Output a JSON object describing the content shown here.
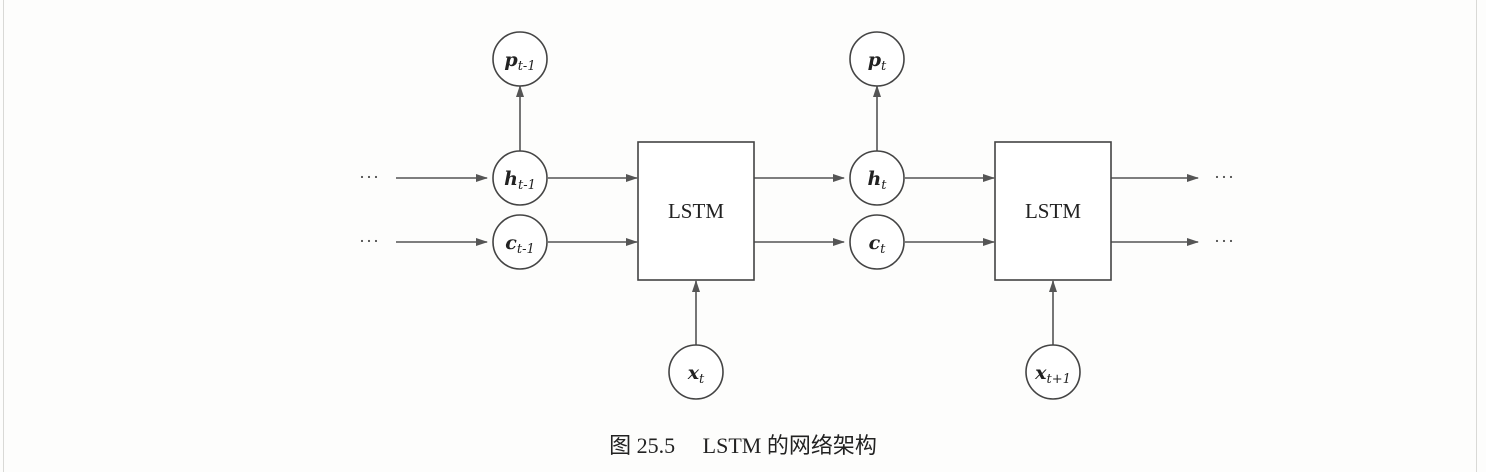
{
  "diagram": {
    "lstm_label": "LSTM",
    "ellipsis": "···",
    "nodes": {
      "p_prev": {
        "main": "p",
        "sub": "t-1"
      },
      "p_t": {
        "main": "p",
        "sub": "t"
      },
      "h_prev": {
        "main": "h",
        "sub": "t-1"
      },
      "c_prev": {
        "main": "c",
        "sub": "t-1"
      },
      "h_t": {
        "main": "h",
        "sub": "t"
      },
      "c_t": {
        "main": "c",
        "sub": "t"
      },
      "x_t": {
        "main": "x",
        "sub": "t"
      },
      "x_next": {
        "main": "x",
        "sub": "t+1"
      }
    }
  },
  "caption": {
    "figure_label": "图 25.5",
    "text": "LSTM 的网络架构"
  }
}
